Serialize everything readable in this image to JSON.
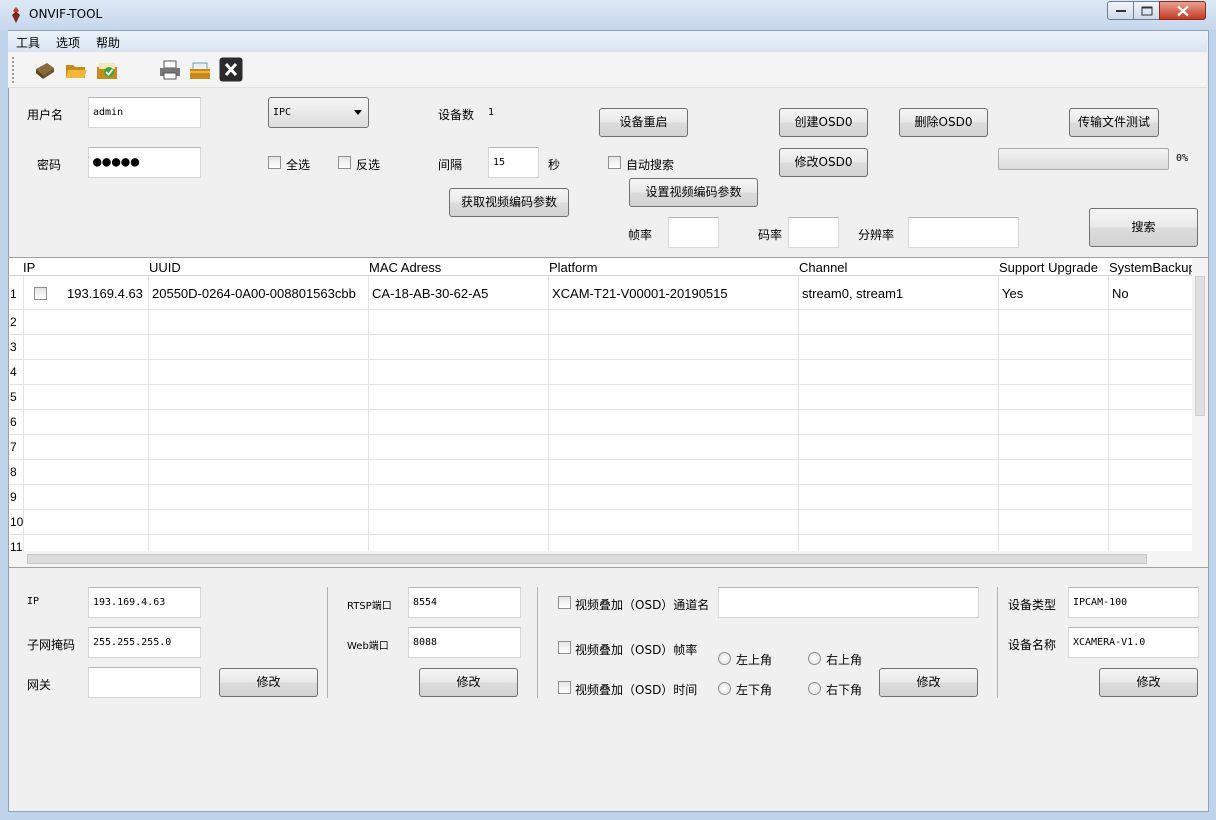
{
  "window": {
    "title": "ONVIF-TOOL"
  },
  "menu": [
    "工具",
    "选项",
    "帮助"
  ],
  "toolbar": {
    "icons": [
      "tool-icon",
      "open-folder-icon",
      "check-icon",
      "printer-icon",
      "folder-tray-icon",
      "close-icon"
    ]
  },
  "login": {
    "username_label": "用户名",
    "username_value": "admin",
    "password_label": "密码",
    "password_value": "●●●●●"
  },
  "device_type_select": "IPC",
  "select_all": "全选",
  "invert_select": "反选",
  "device_count": {
    "label": "设备数",
    "value": "1"
  },
  "interval": {
    "label": "间隔",
    "value": "15",
    "unit": "秒"
  },
  "auto_search": "自动搜索",
  "buttons": {
    "reboot": "设备重启",
    "create_osd": "创建OSD0",
    "delete_osd": "删除OSD0",
    "modify_osd": "修改OSD0",
    "file_transfer_test": "传输文件测试",
    "get_video_params": "获取视频编码参数",
    "set_video_params": "设置视频编码参数",
    "search": "搜索"
  },
  "progress": {
    "value": 0,
    "text": "0%"
  },
  "encoding": {
    "framerate_label": "帧率",
    "bitrate_label": "码率",
    "resolution_label": "分辨率"
  },
  "grid": {
    "headers": [
      "IP",
      "UUID",
      "MAC Adress",
      "Platform",
      "Channel",
      "Support Upgrade",
      "SystemBackup"
    ],
    "row1": {
      "num": "1",
      "ip": "193.169.4.63",
      "uuid": "20550D-0264-0A00-008801563cbb",
      "mac": "CA-18-AB-30-62-A5",
      "platform": "XCAM-T21-V00001-20190515",
      "channel": "stream0, stream1",
      "upgrade": "Yes",
      "backup": "No"
    },
    "row_numbers": [
      "2",
      "3",
      "4",
      "5",
      "6",
      "7",
      "8",
      "9",
      "10",
      "11"
    ]
  },
  "network": {
    "ip_label": "IP",
    "ip_value": "193.169.4.63",
    "mask_label": "子网掩码",
    "mask_value": "255.255.255.0",
    "gateway_label": "网关",
    "gateway_value": "",
    "modify": "修改"
  },
  "ports": {
    "rtsp_label": "RTSP端口",
    "rtsp_value": "8554",
    "web_label": "Web端口",
    "web_value": "8088",
    "modify": "修改"
  },
  "osd": {
    "channel_name": "视频叠加（OSD）通道名",
    "framerate": "视频叠加（OSD）帧率",
    "time": "视频叠加（OSD）时间",
    "top_left": "左上角",
    "top_right": "右上角",
    "bottom_left": "左下角",
    "bottom_right": "右下角",
    "modify": "修改"
  },
  "device_info": {
    "type_label": "设备类型",
    "type_value": "IPCAM-100",
    "name_label": "设备名称",
    "name_value": "XCAMERA-V1.0",
    "modify": "修改"
  }
}
